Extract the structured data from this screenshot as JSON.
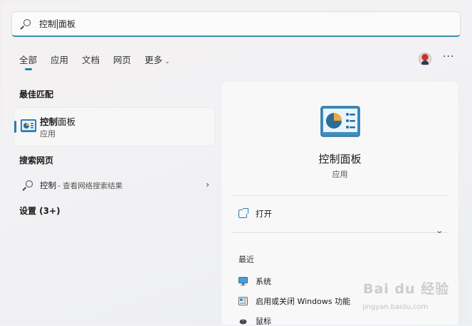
{
  "search": {
    "typed": "控制",
    "rest": "面板"
  },
  "tabs": [
    {
      "label": "全部",
      "active": true
    },
    {
      "label": "应用",
      "active": false
    },
    {
      "label": "文档",
      "active": false
    },
    {
      "label": "网页",
      "active": false
    },
    {
      "label": "更多",
      "active": false
    }
  ],
  "more_chevron": "⌄",
  "more_menu": "···",
  "sections": {
    "best_match": "最佳匹配",
    "search_web": "搜索网页",
    "settings": "设置 (3+)"
  },
  "best_match": {
    "name_bold": "控制",
    "name_rest": "面板",
    "type": "应用"
  },
  "web_result": {
    "query": "控制",
    "hint": " - 查看网络搜索结果",
    "arrow": "›"
  },
  "preview": {
    "title": "控制面板",
    "subtitle": "应用",
    "open_label": "打开",
    "expand_icon": "⌄",
    "recent_label": "最近",
    "recent_items": [
      {
        "label": "系统",
        "icon": "monitor-icon"
      },
      {
        "label": "启用或关闭 Windows 功能",
        "icon": "windows-features-icon"
      },
      {
        "label": "鼠标",
        "icon": "mouse-icon"
      }
    ]
  },
  "watermark": {
    "main": "Bai du 经验",
    "sub": "jingyan.baidu.com"
  },
  "colors": {
    "accent": "#2a7fa3",
    "panel": "#f8f8f9"
  }
}
